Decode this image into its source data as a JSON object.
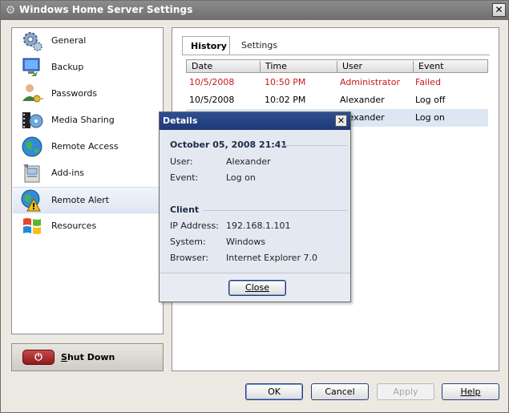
{
  "window": {
    "title": "Windows Home Server Settings",
    "close_glyph": "✕"
  },
  "nav": {
    "items": [
      {
        "label": "General",
        "icon": "gear-icon"
      },
      {
        "label": "Backup",
        "icon": "backup-icon"
      },
      {
        "label": "Passwords",
        "icon": "user-key-icon"
      },
      {
        "label": "Media Sharing",
        "icon": "media-sharing-icon"
      },
      {
        "label": "Remote Access",
        "icon": "globe-icon"
      },
      {
        "label": "Add-ins",
        "icon": "addins-icon"
      },
      {
        "label": "Remote Alert",
        "icon": "globe-alert-icon"
      },
      {
        "label": "Resources",
        "icon": "windows-logo-icon"
      }
    ],
    "selected_index": 6
  },
  "shutdown": {
    "icon_glyph": "⏻",
    "label_first": "S",
    "label_rest": "hut Down"
  },
  "tabs": {
    "history": "History",
    "settings": "Settings"
  },
  "grid": {
    "columns": [
      "Date",
      "Time",
      "User",
      "Event"
    ],
    "rows": [
      {
        "date": "10/5/2008",
        "time": "10:50 PM",
        "user": "Administrator",
        "event": "Failed",
        "status": "error"
      },
      {
        "date": "10/5/2008",
        "time": "10:02 PM",
        "user": "Alexander",
        "event": "Log off",
        "status": "normal"
      },
      {
        "date": "",
        "time": "",
        "user": "Alexander",
        "event": "Log on",
        "status": "selected"
      }
    ]
  },
  "details": {
    "title": "Details",
    "close_glyph": "✕",
    "heading": "October 05, 2008  21:41",
    "user_label": "User:",
    "user_value": "Alexander",
    "event_label": "Event:",
    "event_value": "Log on",
    "client_heading": "Client",
    "ip_label": "IP Address:",
    "ip_value": "192.168.1.101",
    "system_label": "System:",
    "system_value": "Windows",
    "browser_label": "Browser:",
    "browser_value": "Internet Explorer 7.0",
    "close_button": "Close"
  },
  "buttons": {
    "ok": "OK",
    "cancel": "Cancel",
    "apply": "Apply",
    "help": "Help"
  },
  "colors": {
    "error_red": "#c8191b",
    "title_blue": "#1f3877",
    "selection": "#dde7f3"
  }
}
